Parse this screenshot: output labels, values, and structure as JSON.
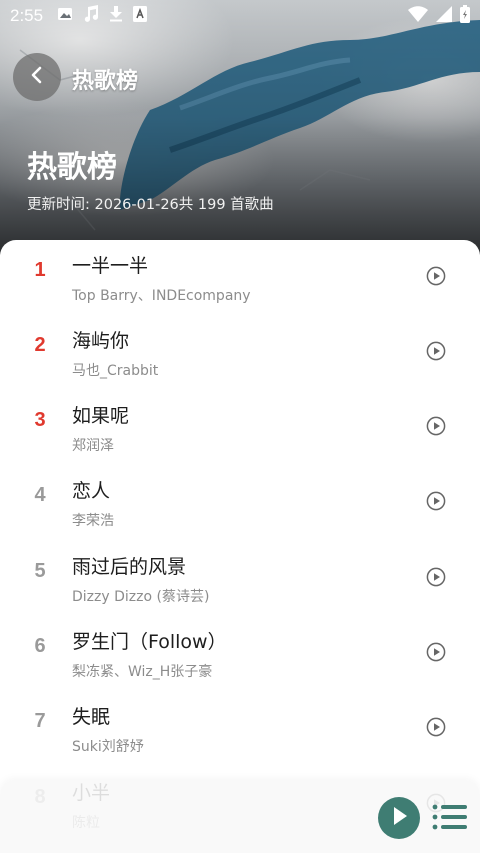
{
  "status_bar": {
    "time": "2:55",
    "left_icons": [
      "image-icon",
      "music-note-icon",
      "download-icon",
      "a-badge-icon"
    ],
    "right_icons": [
      "wifi-icon",
      "signal-icon",
      "battery-icon"
    ]
  },
  "header": {
    "top_title": "热歌榜",
    "title": "热歌榜",
    "update_label": "更新时间: ",
    "update_date": "2026-01-26",
    "count_text": "共 199 首歌曲"
  },
  "songs": [
    {
      "rank": "1",
      "title": "一半一半",
      "artist": "Top Barry、INDEcompany"
    },
    {
      "rank": "2",
      "title": "海屿你",
      "artist": "马也_Crabbit"
    },
    {
      "rank": "3",
      "title": "如果呢",
      "artist": "郑润泽"
    },
    {
      "rank": "4",
      "title": "恋人",
      "artist": "李荣浩"
    },
    {
      "rank": "5",
      "title": "雨过后的风景",
      "artist": "Dizzy Dizzo (蔡诗芸)"
    },
    {
      "rank": "6",
      "title": "罗生门（Follow）",
      "artist": "梨冻紧、Wiz_H张子豪"
    },
    {
      "rank": "7",
      "title": "失眠",
      "artist": "Suki刘舒妤"
    },
    {
      "rank": "8",
      "title": "小半",
      "artist": "陈粒"
    }
  ],
  "colors": {
    "accent_rank": "#e0392e",
    "player_green": "#3f7d73"
  }
}
